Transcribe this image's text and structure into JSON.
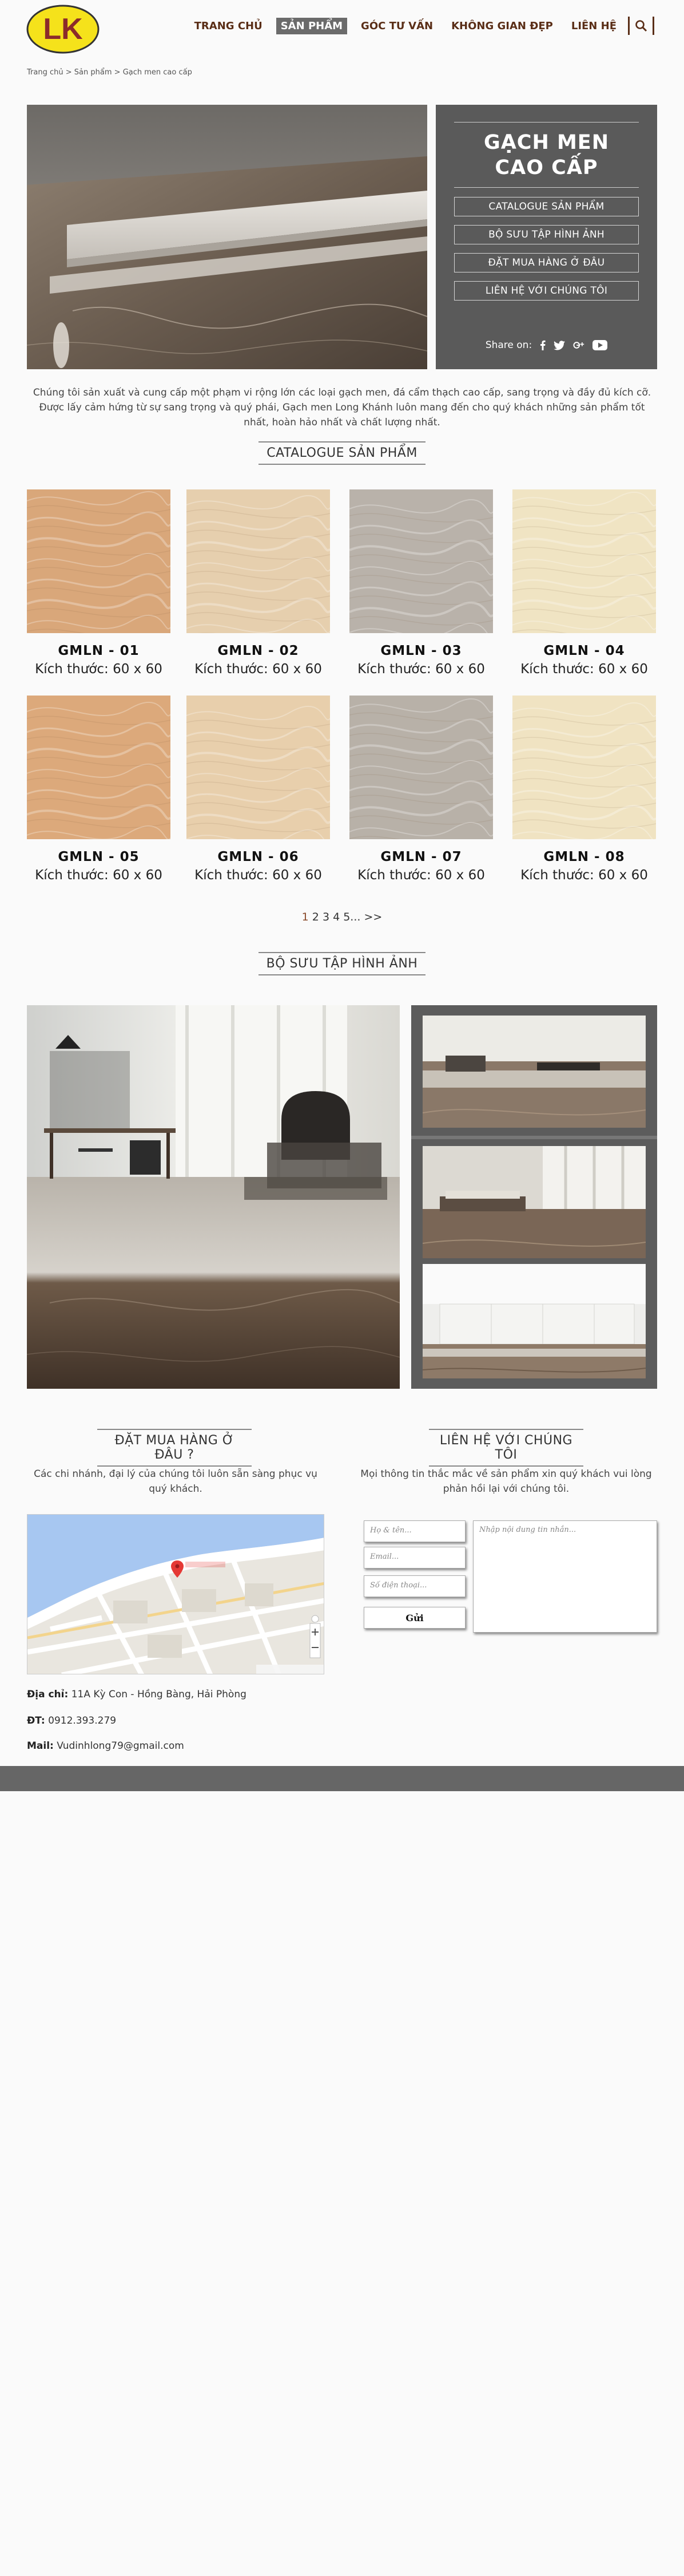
{
  "brand": {
    "logo_text": "LK"
  },
  "nav": {
    "items": [
      "TRANG CHỦ",
      "SẢN PHẨM",
      "GÓC TƯ VẤN",
      "KHÔNG GIAN ĐẸP",
      "LIÊN HỆ"
    ],
    "active": "SẢN PHẨM"
  },
  "breadcrumb": {
    "items": [
      "Trang chủ",
      "Sản phẩm",
      "Gạch men cao cấp"
    ],
    "separator": ">"
  },
  "hero": {
    "title_line1": "GẠCH MEN",
    "title_line2": "CAO CẤP",
    "buttons": [
      "CATALOGUE SẢN PHẨM",
      "BỘ SƯU TẬP HÌNH ẢNH",
      "ĐẶT MUA HÀNG Ở ĐÂU",
      "LIÊN HỆ VỚI CHÚNG TÔI"
    ],
    "share_label": "Share on:",
    "share_icons": [
      "facebook-icon",
      "twitter-icon",
      "google-plus-icon",
      "youtube-icon"
    ]
  },
  "intro": "Chúng tôi sản xuất và cung cấp một phạm vi rộng lớn các loại gạch men, đá cẩm thạch cao cấp, sang trọng và đầy đủ kích cỡ. Được lấy cảm hứng từ sự sang trọng và quý phái, Gạch men Long Khánh luôn mang đến cho quý khách những sản phẩm tốt nhất, hoàn hảo nhất và chất lượng nhất.",
  "catalogue": {
    "title": "CATALOGUE SẢN PHẨM",
    "products": [
      {
        "code": "GMLN - 01",
        "size": "Kích thước: 60 x 60",
        "color": "#d9a77a"
      },
      {
        "code": "GMLN - 02",
        "size": "Kích thước: 60 x 60",
        "color": "#e6cfae"
      },
      {
        "code": "GMLN - 03",
        "size": "Kích thước: 60 x 60",
        "color": "#b9b2aa"
      },
      {
        "code": "GMLN - 04",
        "size": "Kích thước: 60 x 60",
        "color": "#f0e4c3"
      },
      {
        "code": "GMLN - 05",
        "size": "Kích thước: 60 x 60",
        "color": "#dca97b"
      },
      {
        "code": "GMLN - 06",
        "size": "Kích thước: 60 x 60",
        "color": "#e8cfac"
      },
      {
        "code": "GMLN - 07",
        "size": "Kích thước: 60 x 60",
        "color": "#b8b1a8"
      },
      {
        "code": "GMLN - 08",
        "size": "Kích thước: 60 x 60",
        "color": "#f0e3c2"
      }
    ],
    "pagination": [
      "1",
      "2",
      "3",
      "4",
      "5...",
      ">>"
    ],
    "current_page": "1"
  },
  "gallery": {
    "title": "BỘ SƯU TẬP HÌNH ẢNH"
  },
  "where": {
    "title": "ĐẶT MUA HÀNG Ở ĐÂU ?",
    "text": "Các chi nhánh, đại lý của chúng tôi luôn sẵn sàng phục vụ quý khách.",
    "address_label": "Địa chỉ:",
    "address": "11A Kỳ Con - Hồng Bàng, Hải Phòng",
    "phone_label": "ĐT:",
    "phone": "0912.393.279",
    "mail_label": "Mail:",
    "mail": "Vudinhlong79@gmail.com"
  },
  "contact": {
    "title": "LIÊN HỆ VỚI CHÚNG TÔI",
    "text": "Mọi thông tin thắc mắc về sản phẩm xin quý khách vui lòng phản hồi lại với chúng tôi.",
    "name_placeholder": "Họ & tên...",
    "email_placeholder": "Email...",
    "phone_placeholder": "Số điện thoại...",
    "message_placeholder": "Nhập nội dung tin nhắn...",
    "send_label": "Gửi"
  },
  "colors": {
    "nav_text": "#5a2e17",
    "panel_bg": "#5a5a5a",
    "footer_bg": "#666666",
    "logo_yellow": "#f5e21b"
  }
}
